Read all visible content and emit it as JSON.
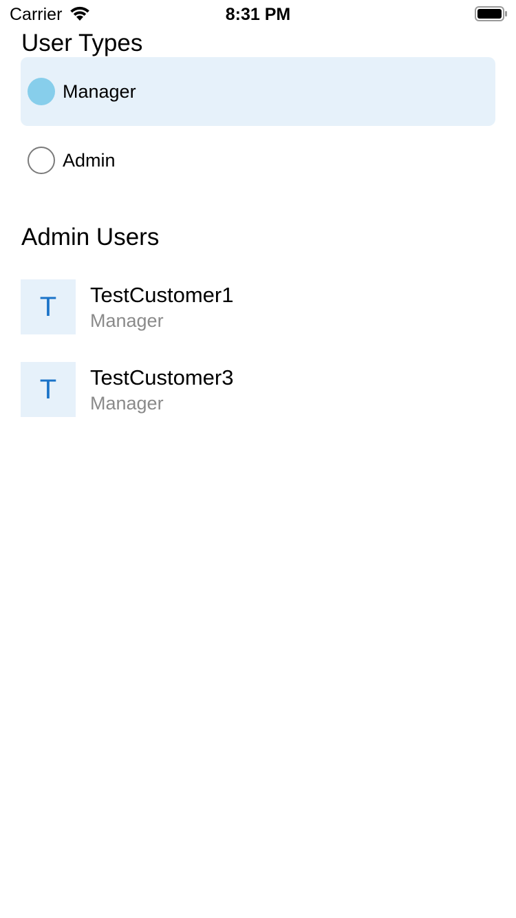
{
  "status_bar": {
    "carrier": "Carrier",
    "time": "8:31 PM",
    "wifi_icon": "wifi-icon",
    "battery_icon": "battery-icon"
  },
  "user_types": {
    "title": "User Types",
    "options": [
      {
        "label": "Manager",
        "selected": true
      },
      {
        "label": "Admin",
        "selected": false
      }
    ]
  },
  "admin_users": {
    "title": "Admin Users",
    "users": [
      {
        "initial": "T",
        "name": "TestCustomer1",
        "role": "Manager"
      },
      {
        "initial": "T",
        "name": "TestCustomer3",
        "role": "Manager"
      }
    ]
  },
  "colors": {
    "selected_background": "#e6f1fa",
    "radio_selected": "#87ceeb",
    "avatar_background": "#e6f1fa",
    "avatar_text": "#1a73c8",
    "secondary_text": "#8a8a8a"
  }
}
